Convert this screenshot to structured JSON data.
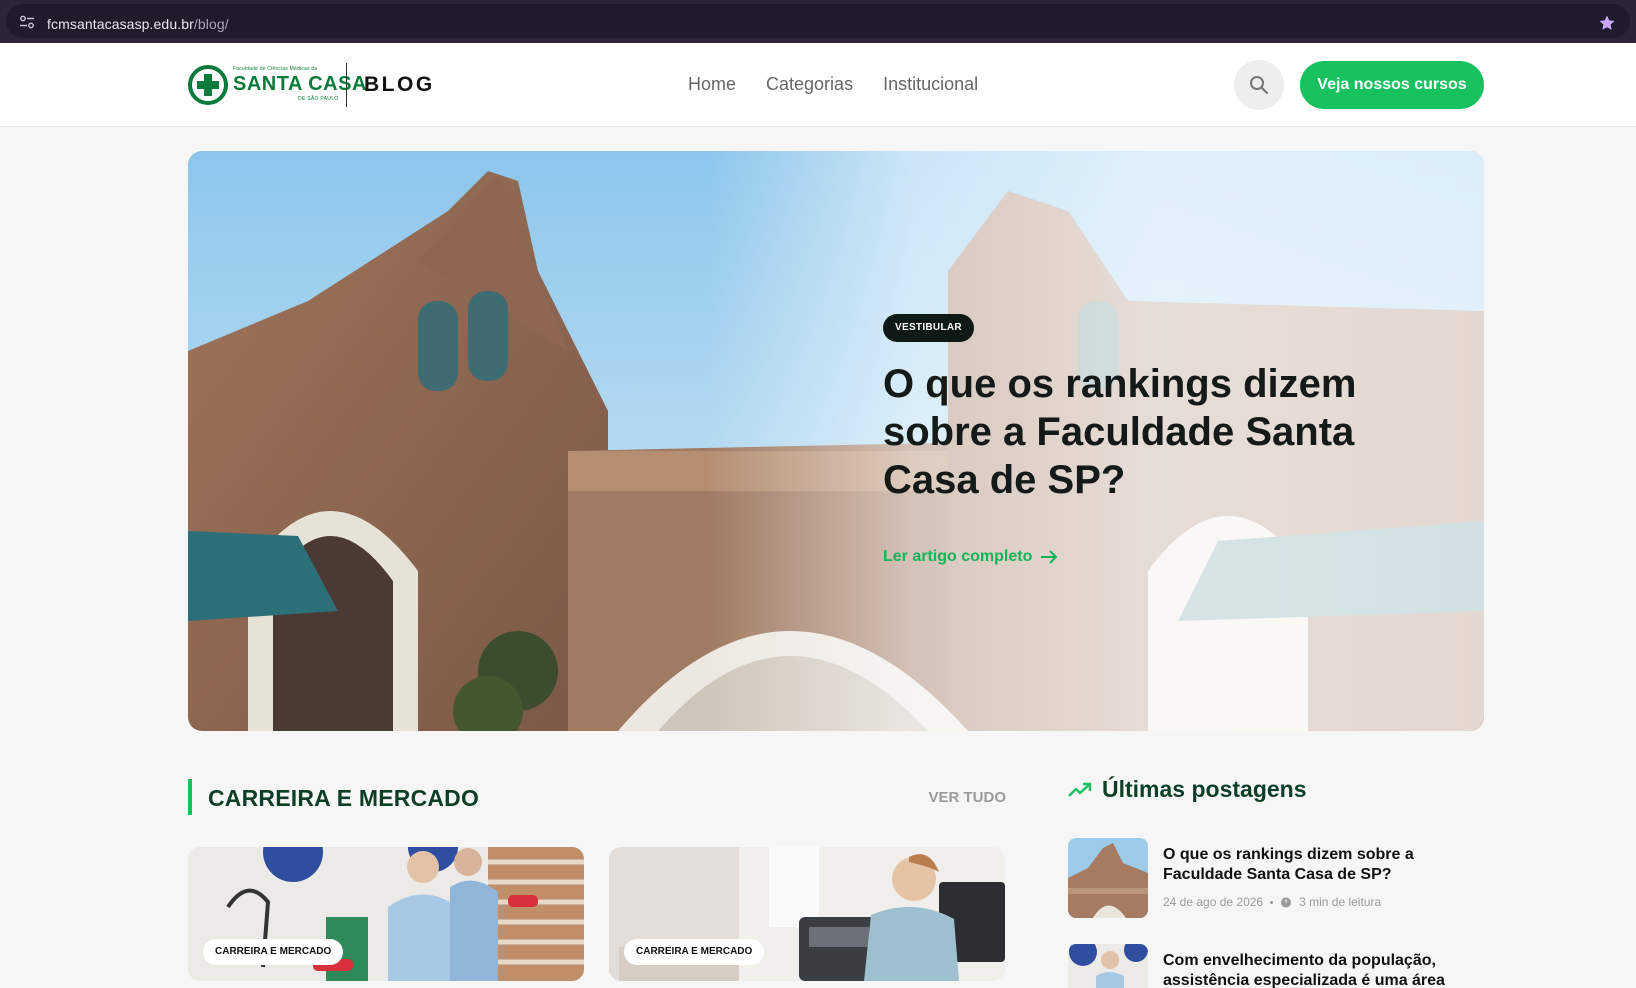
{
  "browser": {
    "url_domain": "fcmsantacasasp.edu.br",
    "url_path": "/blog/"
  },
  "header": {
    "logo_top_line": "Faculdade de Ciências Médicas da",
    "logo_main": "SANTA CASA",
    "logo_sub": "DE SÃO PAULO",
    "blog_label": "BLOG",
    "nav": [
      "Home",
      "Categorias",
      "Institucional"
    ],
    "cta_label": "Veja nossos cursos"
  },
  "hero": {
    "tag": "VESTIBULAR",
    "title": "O que os rankings dizem sobre a Faculdade Santa Casa de SP?",
    "link_label": "Ler artigo completo"
  },
  "career_section": {
    "title": "CARREIRA E MERCADO",
    "see_all": "VER TUDO",
    "cards": [
      {
        "tag": "CARREIRA E MERCADO"
      },
      {
        "tag": "CARREIRA E MERCADO"
      }
    ]
  },
  "latest": {
    "title": "Últimas postagens",
    "posts": [
      {
        "title": "O que os rankings dizem sobre a Faculdade Santa Casa de SP?",
        "date": "24 de ago de 2026",
        "read_time": "3 min de leitura"
      },
      {
        "title": "Com envelhecimento da população, assistência especializada é uma área com"
      }
    ]
  },
  "colors": {
    "brand_green": "#17c25e",
    "dark_green": "#0d3f26",
    "logo_green": "#0a7a3d"
  }
}
